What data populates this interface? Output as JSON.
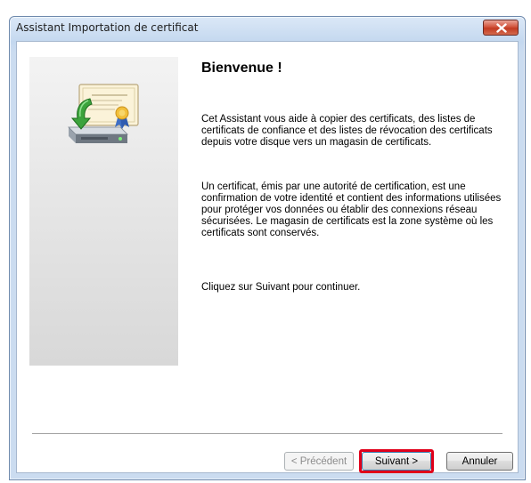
{
  "window": {
    "title": "Assistant Importation de certificat"
  },
  "content": {
    "heading": "Bienvenue !",
    "paragraph1": "Cet Assistant vous aide à copier des certificats, des listes de certificats de confiance et des listes de révocation des certificats depuis votre disque vers un magasin de certificats.",
    "paragraph2": "Un certificat, émis par une autorité de certification, est une confirmation de votre identité et contient des informations utilisées pour protéger vos données ou établir des connexions réseau sécurisées. Le magasin de certificats est la zone système où les certificats sont conservés.",
    "paragraph3": "Cliquez sur Suivant pour continuer."
  },
  "buttons": {
    "previous": "< Précédent",
    "next": "Suivant >",
    "cancel": "Annuler"
  },
  "icons": {
    "wizard_icon": "certificate-import-icon",
    "close_icon": "close-icon"
  },
  "colors": {
    "highlight": "#e0001a",
    "close_button": "#c23b22"
  },
  "state": {
    "previous_enabled": false,
    "next_highlighted": true
  }
}
